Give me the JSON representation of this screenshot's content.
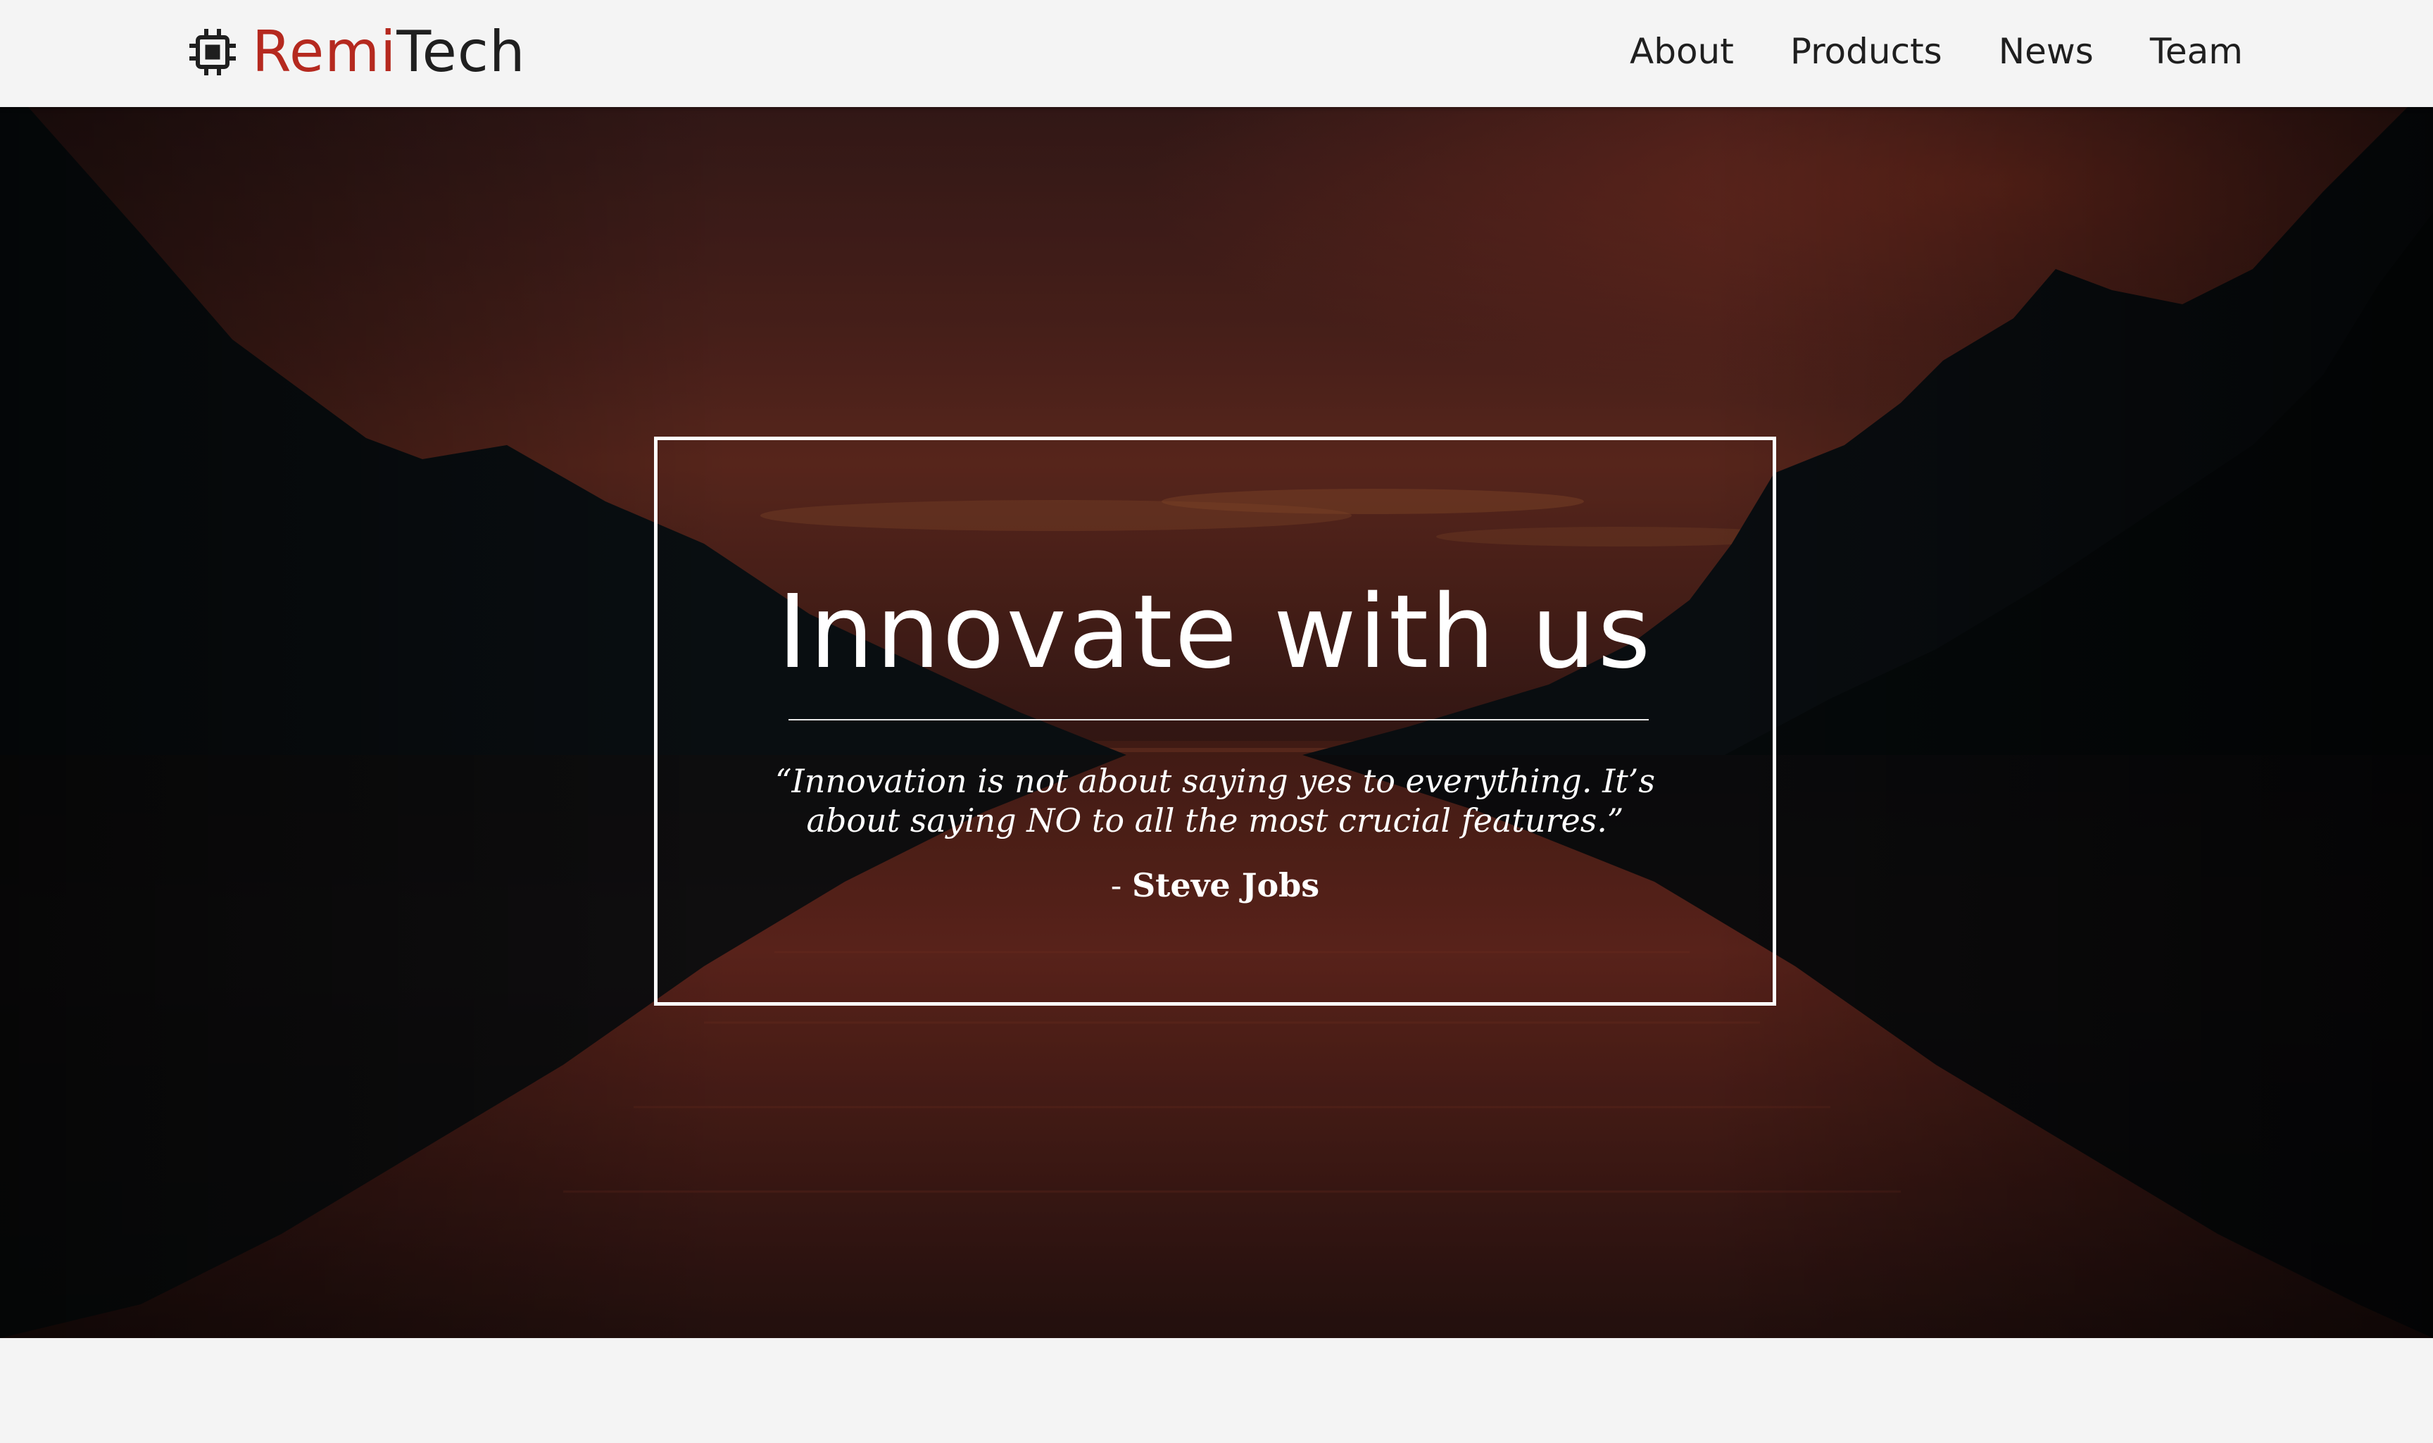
{
  "navbar": {
    "brand": {
      "icon": "chip-icon",
      "name_part1": "Remi",
      "name_part2": "Tech",
      "accent_color": "#b5291f"
    },
    "links": [
      {
        "label": "About"
      },
      {
        "label": "Products"
      },
      {
        "label": "News"
      },
      {
        "label": "Team"
      }
    ]
  },
  "hero": {
    "title": "Innovate with us",
    "quote": "“Innovation is not about saying yes to everything. It’s about saying NO to all the most crucial features.”",
    "author_prefix": "-",
    "author_name": "Steve Jobs"
  }
}
